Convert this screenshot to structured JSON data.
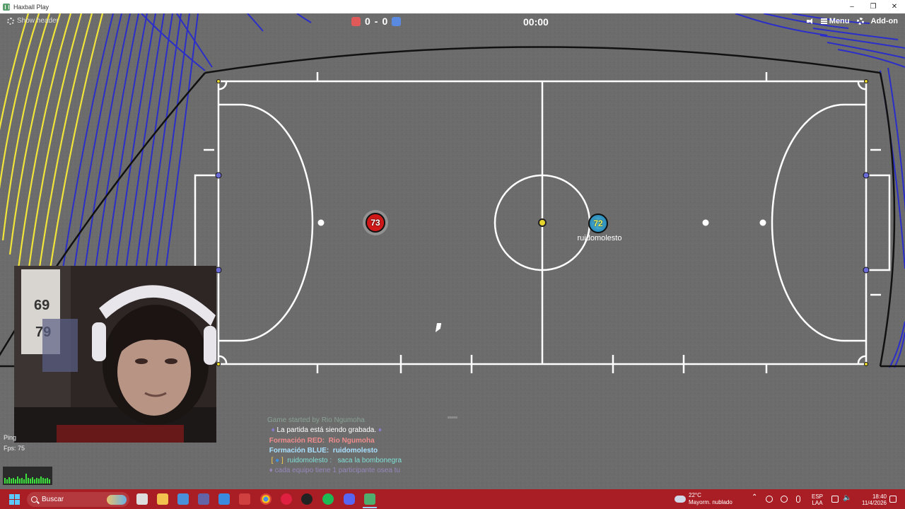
{
  "window": {
    "title": "Haxball Play"
  },
  "hud": {
    "show_header": "Show header",
    "score_red": "0",
    "score_sep": "-",
    "score_blue": "0",
    "timer": "00:00",
    "menu_label": "Menu",
    "addon_label": "Add-on",
    "red_color": "#e05a5a",
    "blue_color": "#5a8ae0"
  },
  "players": {
    "red_number": "73",
    "blue_number": "72",
    "blue_name": "ruidomolesto"
  },
  "stats": {
    "ping_label": "Ping",
    "fps_label": "Fps: 75"
  },
  "chat": {
    "lines": [
      {
        "text": "Game started by Rio Ngumoha"
      },
      {
        "text": "La partida está siendo grabada."
      },
      {
        "label": "Formación RED:",
        "value": "Rio Ngumoha"
      },
      {
        "label": "Formación BLUE:",
        "value": "ruidomolesto"
      },
      {
        "name": "ruidomolesto :",
        "text": "saca la bombonegra"
      },
      {
        "text": "cada equipo tiene 1 participante osea tu"
      }
    ]
  },
  "taskbar": {
    "search_placeholder": "Buscar",
    "weather_temp": "22°C",
    "weather_desc": "Mayorm. nublado",
    "lang_1": "ESP",
    "lang_2": "LAA",
    "time": "18:40",
    "date": "11/4/2026"
  }
}
